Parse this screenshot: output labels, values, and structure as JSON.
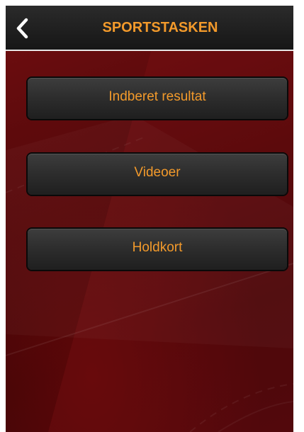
{
  "navbar": {
    "title": "SPORTSTASKEN",
    "back_icon": "chevron-left-icon"
  },
  "menu": {
    "items": [
      {
        "label": "Indberet resultat"
      },
      {
        "label": "Videoer"
      },
      {
        "label": "Holdkort"
      }
    ]
  },
  "colors": {
    "accent": "#f39a2b",
    "navbar": "#1e1e1e",
    "background": "#4d0709"
  }
}
